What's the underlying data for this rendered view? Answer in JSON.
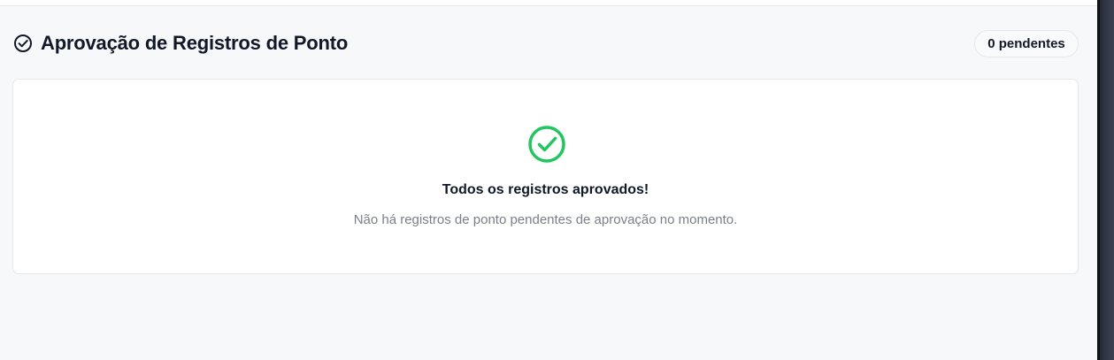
{
  "header": {
    "title": "Aprovação de Registros de Ponto",
    "badge": "0 pendentes"
  },
  "empty_state": {
    "title": "Todos os registros aprovados!",
    "subtitle": "Não há registros de ponto pendentes de aprovação no momento."
  },
  "icons": {
    "title_icon": "check-circle-icon",
    "empty_icon": "check-circle-icon"
  },
  "colors": {
    "page_background": "#f7f8fa",
    "card_background": "#ffffff",
    "success": "#22c55e",
    "text_primary": "#111827",
    "text_secondary": "#7a7f87"
  }
}
